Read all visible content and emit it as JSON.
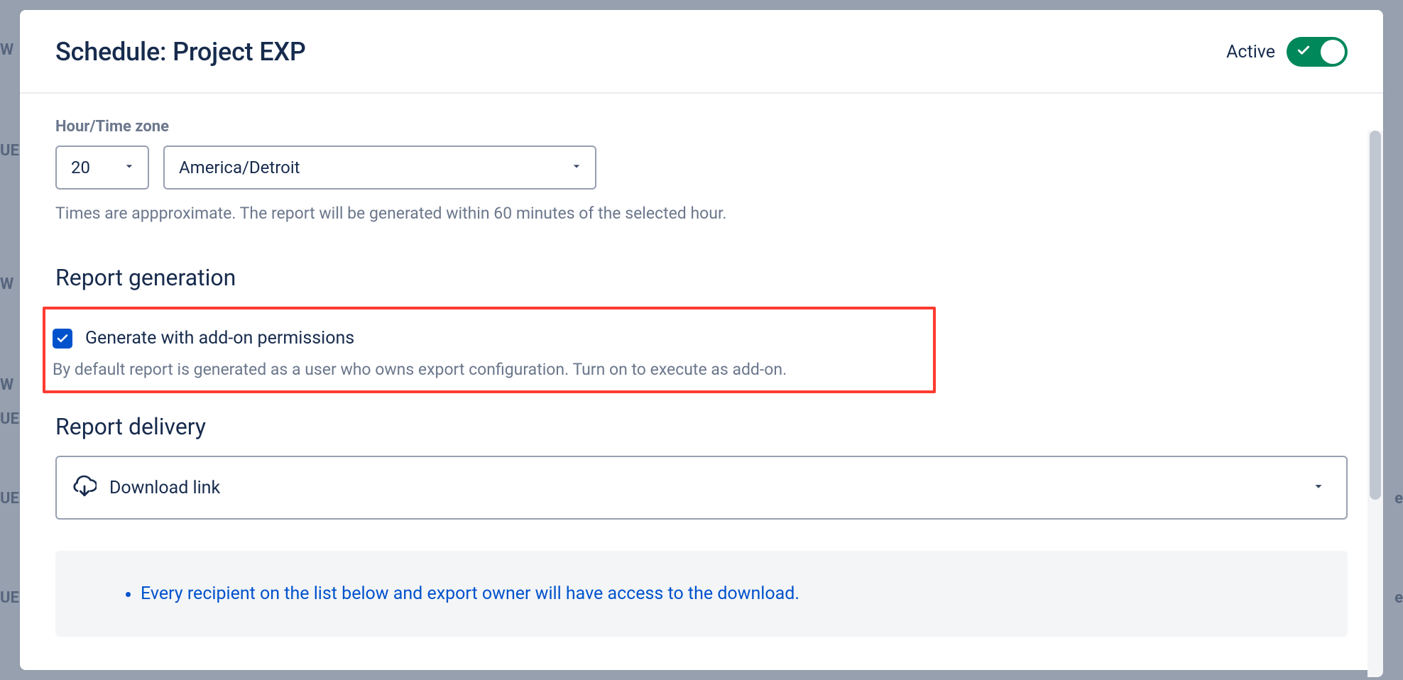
{
  "background_fragments": [
    "W",
    "UE",
    "W",
    "W",
    "UE",
    "UE",
    "UE",
    "e",
    "e"
  ],
  "header": {
    "title": "Schedule: Project EXP",
    "active_label": "Active",
    "active_on": true
  },
  "timezone": {
    "label": "Hour/Time zone",
    "hour_value": "20",
    "tz_value": "America/Detroit",
    "helper": "Times are appproximate. The report will be generated within 60 minutes of the selected hour."
  },
  "generation": {
    "title": "Report generation",
    "checkbox_label": "Generate with add-on permissions",
    "checkbox_checked": true,
    "helper": "By default report is generated as a user who owns export configuration. Turn on to execute as add-on."
  },
  "delivery": {
    "title": "Report delivery",
    "selected": "Download link",
    "info_item": "Every recipient on the list below and export owner will have access to the download."
  }
}
